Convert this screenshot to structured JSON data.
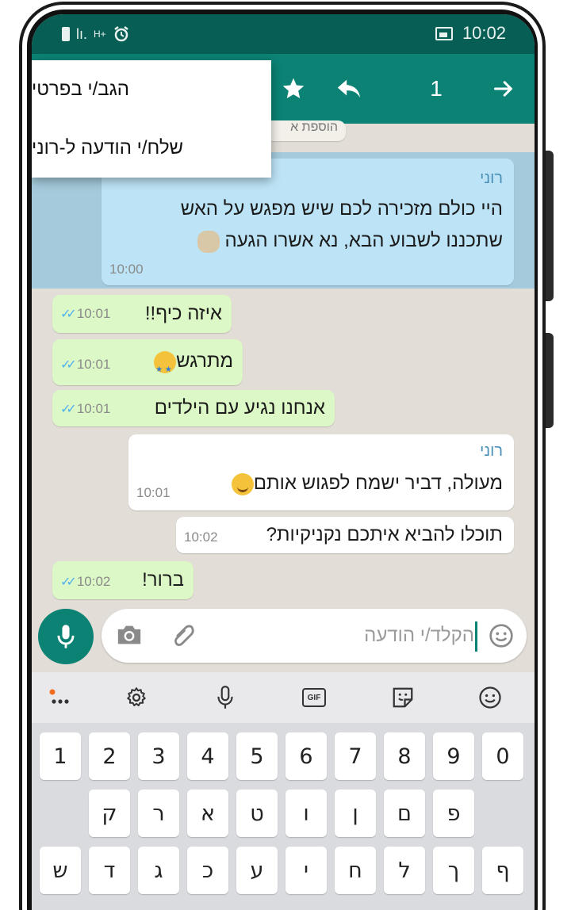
{
  "status_bar": {
    "time": "10:02",
    "signal": "lı.",
    "network": "H+"
  },
  "action_bar": {
    "count": "1"
  },
  "popup_menu": {
    "items": [
      "הגב/י בפרטי",
      "שלח/י הודעה ל-רוני"
    ]
  },
  "chat": {
    "obscured_header": "הוספת א",
    "messages": [
      {
        "sender": "רוני",
        "line1": "היי כולם מזכירה לכם שיש מפגש על האש",
        "line2": "שתכננו לשבוע הבא, נא אשרו הגעה",
        "time": "10:00"
      },
      {
        "text": "איזה כיף!!",
        "time": "10:01"
      },
      {
        "text": "מתרגש",
        "time": "10:01"
      },
      {
        "text": "אנחנו נגיע עם הילדים",
        "time": "10:01"
      },
      {
        "sender": "רוני",
        "text": "מעולה, דביר ישמח לפגוש אותם",
        "time": "10:01"
      },
      {
        "text": "תוכלו להביא איתכם נקניקיות?",
        "time": "10:02"
      },
      {
        "text": "ברור!",
        "time": "10:02"
      }
    ]
  },
  "input": {
    "placeholder": "הקלד/י הודעה"
  },
  "keyboard": {
    "row1": [
      "1",
      "2",
      "3",
      "4",
      "5",
      "6",
      "7",
      "8",
      "9",
      "0"
    ],
    "row2": [
      "ק",
      "ר",
      "א",
      "ט",
      "ו",
      "ן",
      "ם",
      "פ"
    ],
    "row3": [
      "ש",
      "ד",
      "ג",
      "כ",
      "ע",
      "י",
      "ח",
      "ל",
      "ך",
      "ף"
    ],
    "gif_label": "GIF"
  },
  "colors": {
    "header": "#0b8274",
    "status": "#075e54",
    "outgoing": "#dcf8c6",
    "incoming": "#ffffff"
  }
}
